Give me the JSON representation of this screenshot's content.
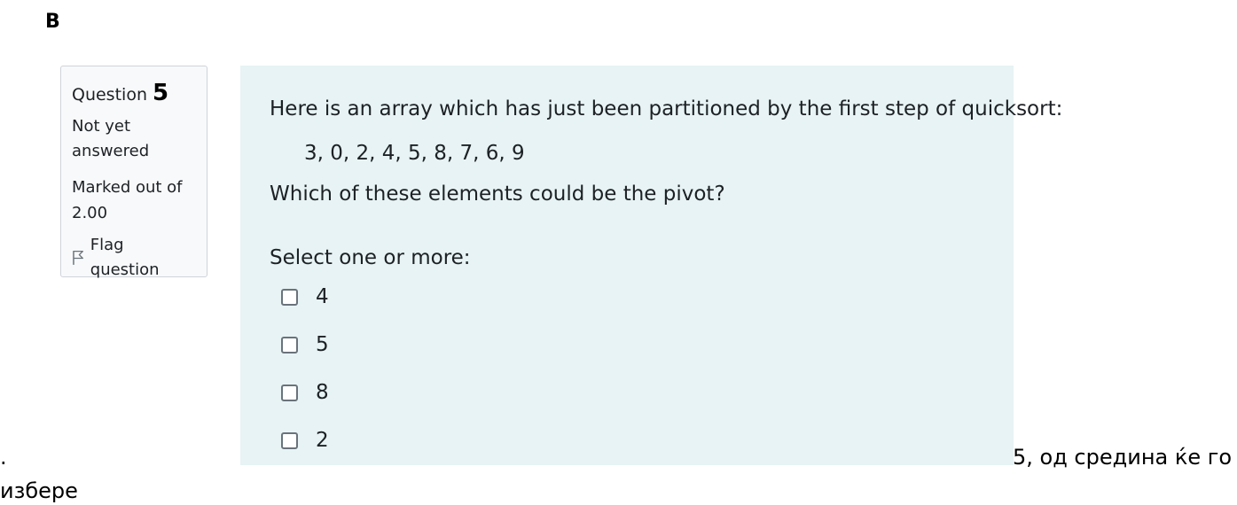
{
  "section_letter": "B",
  "info": {
    "question_word": "Question",
    "question_number": "5",
    "state": "Not yet answered",
    "grade": "Marked out of 2.00",
    "flag_label": "Flag question",
    "flag_icon": "flag-icon"
  },
  "question": {
    "intro": "Here is an array which has just been partitioned by the first step of quicksort:",
    "array": "3, 0, 2, 4, 5, 8, 7, 6, 9",
    "prompt": "Which of these elements could be the pivot?",
    "select_label": "Select one or more:",
    "options": [
      {
        "label": "4",
        "checked": false
      },
      {
        "label": "5",
        "checked": false
      },
      {
        "label": "8",
        "checked": false
      },
      {
        "label": "2",
        "checked": false
      }
    ]
  },
  "surrounding_text": {
    "dot": ".",
    "right": "5, од средина ќе го",
    "next_line": "избере"
  },
  "colors": {
    "content_background": "#e7f3f5",
    "info_background": "#f8f9fa",
    "info_border": "#cfd4d9"
  }
}
